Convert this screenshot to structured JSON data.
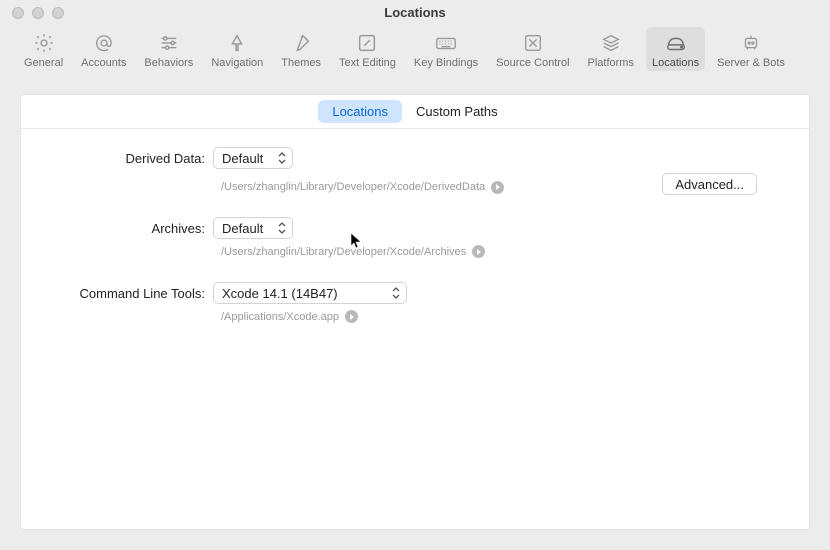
{
  "window": {
    "title": "Locations"
  },
  "toolbar": {
    "items": [
      {
        "label": "General"
      },
      {
        "label": "Accounts"
      },
      {
        "label": "Behaviors"
      },
      {
        "label": "Navigation"
      },
      {
        "label": "Themes"
      },
      {
        "label": "Text Editing"
      },
      {
        "label": "Key Bindings"
      },
      {
        "label": "Source Control"
      },
      {
        "label": "Platforms"
      },
      {
        "label": "Locations"
      },
      {
        "label": "Server & Bots"
      }
    ]
  },
  "tabs": {
    "locations": "Locations",
    "custom_paths": "Custom Paths"
  },
  "labels": {
    "derived_data": "Derived Data:",
    "archives": "Archives:",
    "cli": "Command Line Tools:",
    "advanced": "Advanced..."
  },
  "values": {
    "derived_data_select": "Default",
    "derived_data_path": "/Users/zhanglin/Library/Developer/Xcode/DerivedData",
    "archives_select": "Default",
    "archives_path": "/Users/zhanglin/Library/Developer/Xcode/Archives",
    "cli_select": "Xcode 14.1 (14B47)",
    "cli_path": "/Applications/Xcode.app"
  }
}
